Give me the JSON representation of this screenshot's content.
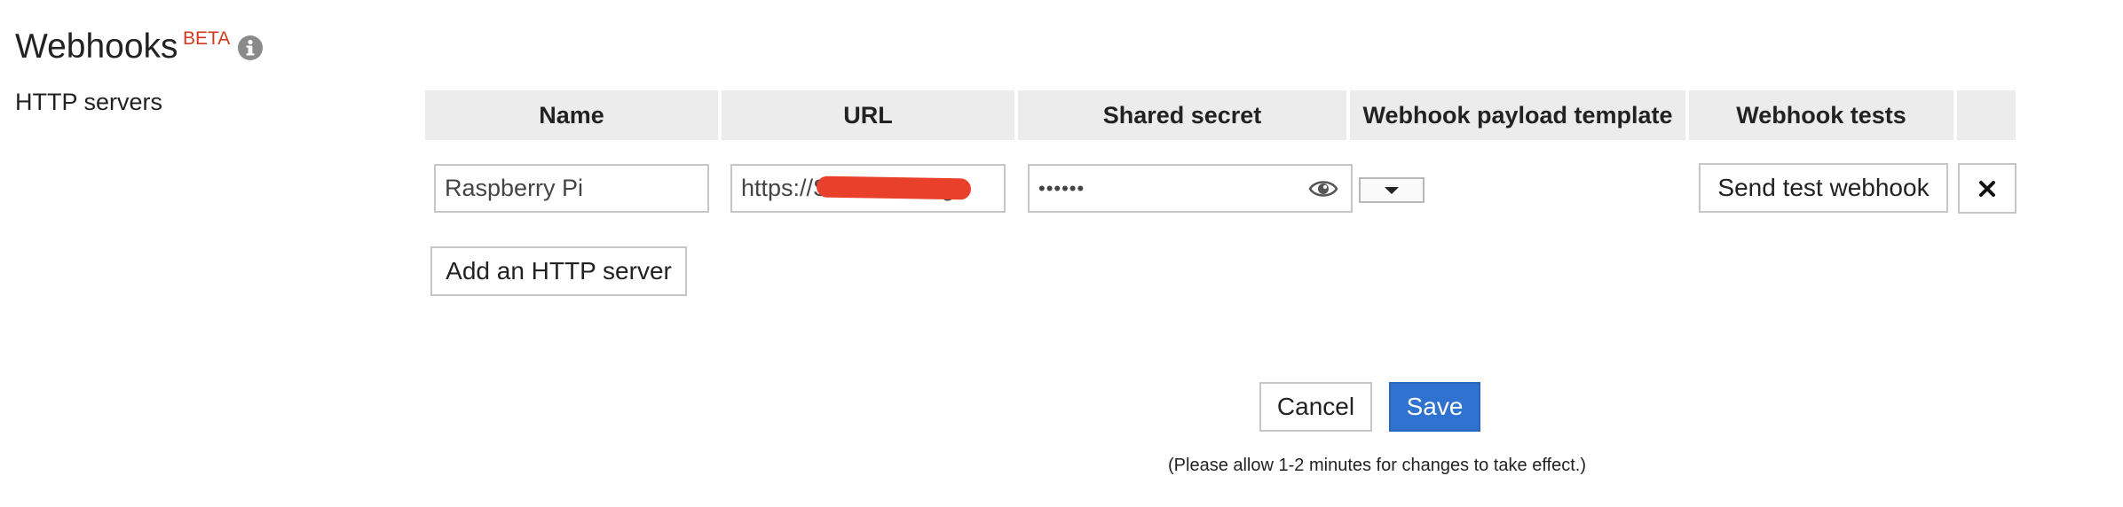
{
  "header": {
    "title": "Webhooks",
    "badge": "BETA",
    "info_icon": "info-icon"
  },
  "section": {
    "label": "HTTP servers"
  },
  "table": {
    "columns": [
      "Name",
      "URL",
      "Shared secret",
      "Webhook payload template",
      "Webhook tests",
      ""
    ],
    "rows": [
      {
        "name": "Raspberry Pi",
        "url": "https://S•••••••••••.ng",
        "secret_masked": "••••••",
        "secret_icon": "eye-icon",
        "template_value": "",
        "test_button": "Send test webhook",
        "remove_icon": "close-icon"
      }
    ]
  },
  "actions": {
    "add_server": "Add an HTTP server",
    "cancel": "Cancel",
    "save": "Save",
    "note": "(Please allow 1-2 minutes for changes to take effect.)"
  },
  "colors": {
    "beta": "#d23a1f",
    "primary": "#2f72cf",
    "header_bg": "#ececec",
    "redaction": "#e8402a"
  }
}
